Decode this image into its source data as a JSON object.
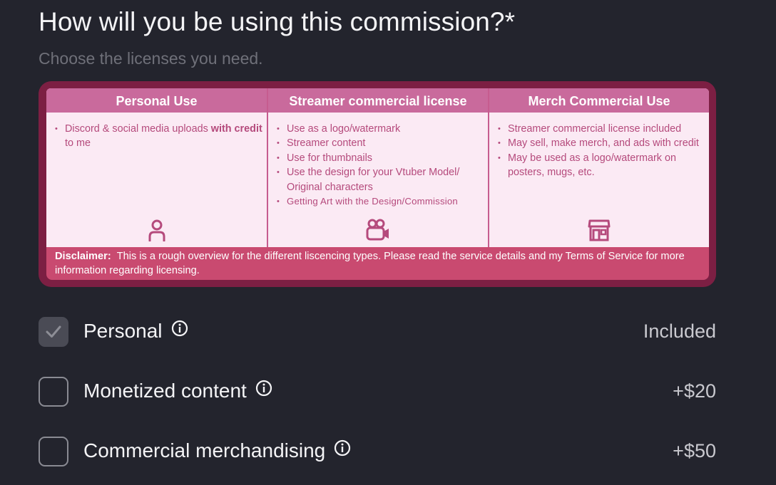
{
  "header": {
    "title": "How will you be using this commission?*",
    "subtitle": "Choose the licenses you need."
  },
  "license_table": {
    "columns": [
      {
        "title": "Personal Use",
        "items": [
          {
            "text": "Discord & social media uploads",
            "bold_suffix": "with credit",
            "suffix": " to me"
          }
        ],
        "icon": "person-icon"
      },
      {
        "title": "Streamer commercial license",
        "items": [
          {
            "text": "Use as a logo/watermark"
          },
          {
            "text": "Streamer content"
          },
          {
            "text": "Use for thumbnails"
          },
          {
            "text": "Use the design for your Vtuber Model/ Original characters"
          },
          {
            "text": "Getting Art with the Design/Commission"
          }
        ],
        "icon": "video-camera-icon"
      },
      {
        "title": "Merch Commercial Use",
        "items": [
          {
            "text": "Streamer commercial license included"
          },
          {
            "text": "May sell, make merch, and ads with credit"
          },
          {
            "text": "May be used as a logo/watermark on posters, mugs, etc."
          }
        ],
        "icon": "storefront-icon"
      }
    ],
    "disclaimer_label": "Disclaimer:",
    "disclaimer_text": "This is a rough overview for the different liscencing types. Please read the service details and my Terms of Service for more information regarding licensing."
  },
  "options": [
    {
      "label": "Personal",
      "price": "Included",
      "checked": true
    },
    {
      "label": "Monetized content",
      "price": "+$20",
      "checked": false
    },
    {
      "label": "Commercial merchandising",
      "price": "+$50",
      "checked": false
    }
  ],
  "colors": {
    "background": "#23242d",
    "card_border": "#7c1f43",
    "table_header": "#c96a9c",
    "table_body": "#fbeaf4",
    "table_text": "#b54a7c",
    "disclaimer_bg": "#c94a70"
  }
}
